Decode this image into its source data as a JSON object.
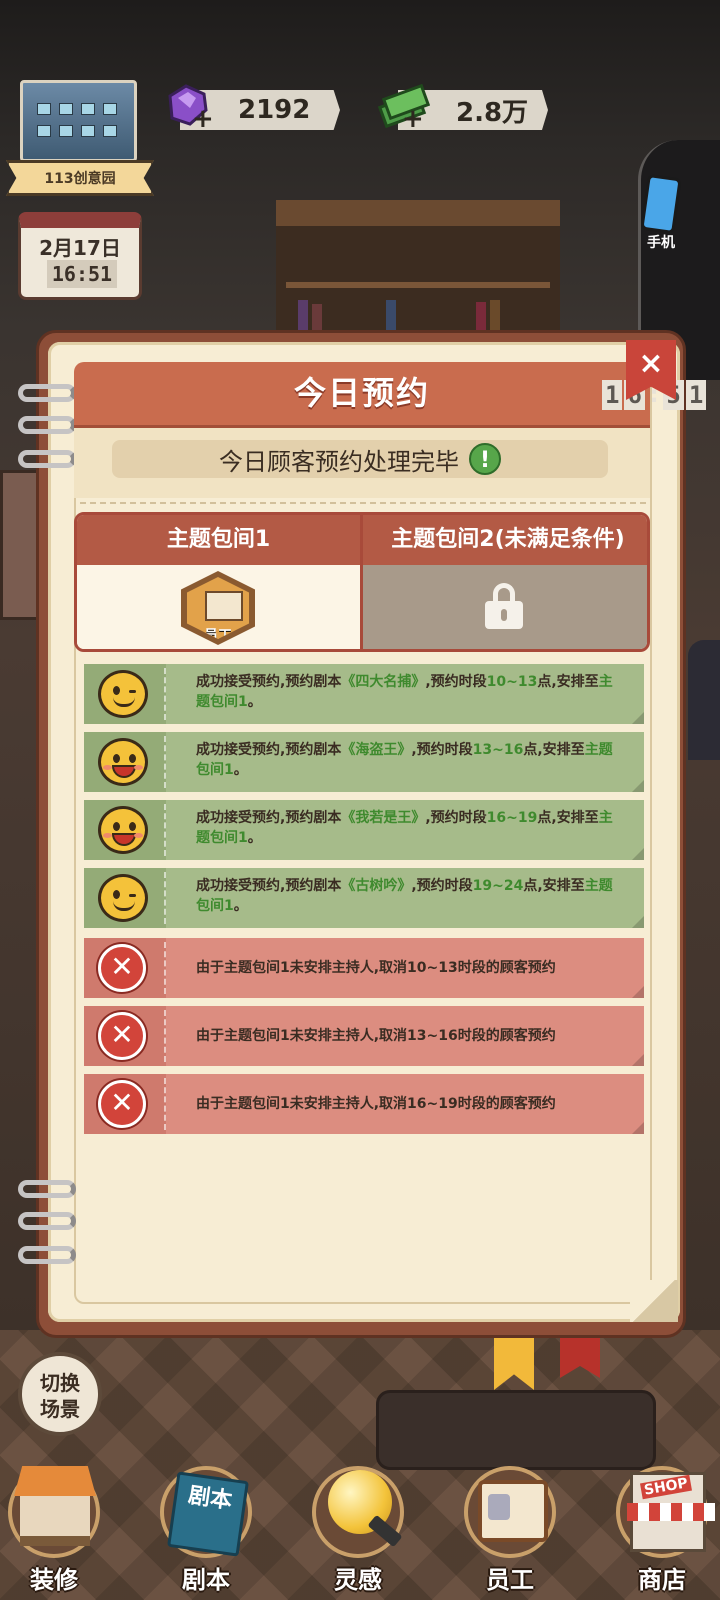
{
  "hud": {
    "location": "113创意园",
    "gems": "2192",
    "cash": "2.8万",
    "calendar_date": "2月17日",
    "calendar_time": "16:51",
    "phone_label": "手机"
  },
  "panel": {
    "title": "今日预约",
    "clock": [
      "1",
      "6",
      "5",
      "1"
    ],
    "status": "今日顾客预约处理完毕",
    "close_label": "×",
    "rooms": [
      {
        "label": "主题包间1",
        "staff_label": "员工"
      },
      {
        "label": "主题包间2(未满足条件)"
      }
    ]
  },
  "logs": [
    {
      "type": "success",
      "face": "wink",
      "pre": "成功接受预约,预约剧本",
      "script": "《四大名捕》",
      "mid": ",预约时段",
      "time": "10~13",
      "post": "点,安排至",
      "room": "主题包间1",
      "end": "。"
    },
    {
      "type": "success",
      "face": "happy",
      "pre": "成功接受预约,预约剧本",
      "script": "《海盗王》",
      "mid": ",预约时段",
      "time": "13~16",
      "post": "点,安排至",
      "room": "主题包间1",
      "end": "。"
    },
    {
      "type": "success",
      "face": "happy",
      "pre": "成功接受预约,预约剧本",
      "script": "《我若是王》",
      "mid": ",预约时段",
      "time": "16~19",
      "post": "点,安排至",
      "room": "主题包间1",
      "end": "。"
    },
    {
      "type": "success",
      "face": "wink",
      "pre": "成功接受预约,预约剧本",
      "script": "《古树吟》",
      "mid": ",预约时段",
      "time": "19~24",
      "post": "点,安排至",
      "room": "主题包间1",
      "end": "。"
    },
    {
      "type": "fail",
      "text": "由于主题包间1未安排主持人,取消10~13时段的顾客预约"
    },
    {
      "type": "fail",
      "text": "由于主题包间1未安排主持人,取消13~16时段的顾客预约"
    },
    {
      "type": "fail",
      "text": "由于主题包间1未安排主持人,取消16~19时段的顾客预约"
    }
  ],
  "switch_scene": [
    "切换",
    "场景"
  ],
  "nav": [
    {
      "label": "装修",
      "icon": "renovate-house-icon"
    },
    {
      "label": "剧本",
      "icon": "script-book-icon",
      "icon_text": "剧本"
    },
    {
      "label": "灵感",
      "icon": "inspiration-bulb-icon"
    },
    {
      "label": "员工",
      "icon": "staff-card-icon"
    },
    {
      "label": "商店",
      "icon": "shop-icon",
      "icon_text": "SHOP"
    }
  ],
  "colors": {
    "header": "#c96c4e",
    "success_row": "#a6bb8a",
    "fail_row": "#dc8d80",
    "highlight": "#3f8a2e"
  }
}
